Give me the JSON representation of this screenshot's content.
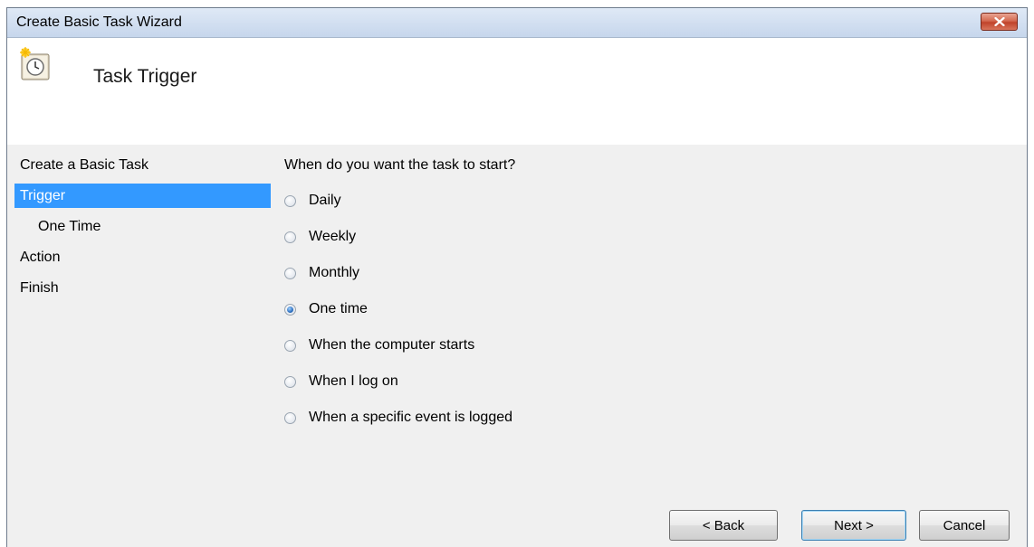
{
  "window": {
    "title": "Create Basic Task Wizard"
  },
  "header": {
    "title": "Task Trigger",
    "icon": "scheduled-task-clock-icon"
  },
  "steps": [
    {
      "label": "Create a Basic Task",
      "active": false,
      "sub": false
    },
    {
      "label": "Trigger",
      "active": true,
      "sub": false
    },
    {
      "label": "One Time",
      "active": false,
      "sub": true
    },
    {
      "label": "Action",
      "active": false,
      "sub": false
    },
    {
      "label": "Finish",
      "active": false,
      "sub": false
    }
  ],
  "content": {
    "question": "When do you want the task to start?",
    "options": [
      {
        "label": "Daily",
        "checked": false
      },
      {
        "label": "Weekly",
        "checked": false
      },
      {
        "label": "Monthly",
        "checked": false
      },
      {
        "label": "One time",
        "checked": true
      },
      {
        "label": "When the computer starts",
        "checked": false
      },
      {
        "label": "When I log on",
        "checked": false
      },
      {
        "label": "When a specific event is logged",
        "checked": false
      }
    ]
  },
  "buttons": {
    "back": "< Back",
    "next": "Next >",
    "cancel": "Cancel"
  },
  "colors": {
    "selection": "#3399ff",
    "titlebar": "#c6d6ec",
    "close": "#c0432a"
  }
}
